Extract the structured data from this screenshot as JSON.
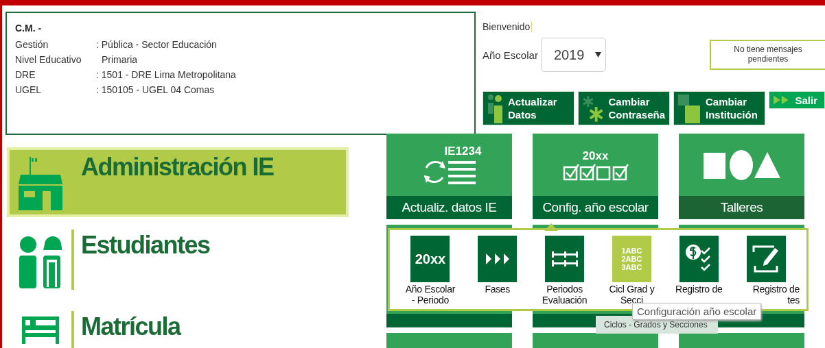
{
  "institution": {
    "title": "C.M. -",
    "fields": [
      {
        "label": "Gestión",
        "value": ": Pública - Sector Educación"
      },
      {
        "label": "Nivel Educativo",
        "value": "Primaria"
      },
      {
        "label": "DRE",
        "value": ": 1501 - DRE Lima Metropolitana"
      },
      {
        "label": "UGEL",
        "value": ": 150105 - UGEL 04 Comas"
      }
    ]
  },
  "user": {
    "greeting": "Bienvenido",
    "year_label": "Año Escolar",
    "year": "2019"
  },
  "messages": {
    "text": "No tiene mensajes pendientes"
  },
  "actions": [
    {
      "kind": "info",
      "label": [
        "Actualizar",
        "Datos"
      ]
    },
    {
      "kind": "password",
      "label": [
        "Cambiar",
        "Contraseña"
      ]
    },
    {
      "kind": "institution",
      "label": [
        "Cambiar",
        "Institución"
      ]
    },
    {
      "kind": "exit",
      "label": [
        "Salir"
      ]
    }
  ],
  "menu": [
    {
      "kind": "school",
      "label": "Administración IE",
      "selected": true
    },
    {
      "kind": "students",
      "label": "Estudiantes",
      "selected": false
    },
    {
      "kind": "enrollment",
      "label": "Matrícula",
      "selected": false
    }
  ],
  "tiles": [
    {
      "kind": "update",
      "caption": "IE1234",
      "label": "Actualiz. datos IE"
    },
    {
      "kind": "year",
      "caption": "20xx",
      "label": "Config. año escolar"
    },
    {
      "kind": "shapes",
      "label": "Talleres"
    }
  ],
  "submenu": {
    "items": [
      {
        "kind": "year",
        "caption": "20xx",
        "label": [
          "Año Escolar",
          "- Periodo"
        ],
        "selected": false
      },
      {
        "kind": "phases",
        "label": [
          "Fases"
        ],
        "selected": false
      },
      {
        "kind": "periods",
        "label": [
          "Periodos",
          "Evaluación"
        ],
        "selected": false
      },
      {
        "kind": "sections",
        "captions": [
          "1ABC",
          "2ABC",
          "3ABC"
        ],
        "label": [
          "Cicl Grad y",
          "Secci"
        ],
        "selected": true
      },
      {
        "kind": "payment",
        "label": [
          "Registro de"
        ],
        "selected": false
      },
      {
        "kind": "edit",
        "label": [
          "Registro de",
          "tes"
        ],
        "selected": false
      }
    ],
    "tooltip": "Configuración año escolar",
    "hint": "Ciclos - Grados y Secciones"
  }
}
